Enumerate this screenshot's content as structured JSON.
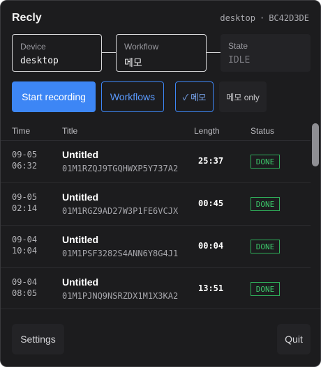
{
  "app": {
    "title": "Recly",
    "device": "desktop",
    "separator": "·",
    "device_id": "BC42D3DE"
  },
  "status_boxes": {
    "device": {
      "label": "Device",
      "value": "desktop"
    },
    "workflow": {
      "label": "Workflow",
      "value": "메모"
    },
    "state": {
      "label": "State",
      "value": "IDLE"
    }
  },
  "toolbar": {
    "start_label": "Start recording",
    "workflows_label": "Workflows",
    "memo_filter_label": "✓ 메모",
    "memo_only_label": "메모 only"
  },
  "table": {
    "columns": {
      "time": "Time",
      "title": "Title",
      "length": "Length",
      "status": "Status"
    },
    "rows": [
      {
        "date": "09-05",
        "time": "06:32",
        "title": "Untitled",
        "id": "01M1RZQJ9TGQHWXP5Y737A2",
        "length": "25:37",
        "status": "DONE"
      },
      {
        "date": "09-05",
        "time": "02:14",
        "title": "Untitled",
        "id": "01M1RGZ9AD27W3P1FE6VCJX",
        "length": "00:45",
        "status": "DONE"
      },
      {
        "date": "09-04",
        "time": "10:04",
        "title": "Untitled",
        "id": "01M1PSF3282S4ANN6Y8G4J1",
        "length": "00:04",
        "status": "DONE"
      },
      {
        "date": "09-04",
        "time": "08:05",
        "title": "Untitled",
        "id": "01M1PJNQ9NSRZDX1M1X3KA2",
        "length": "13:51",
        "status": "DONE"
      }
    ]
  },
  "footer": {
    "settings_label": "Settings",
    "quit_label": "Quit"
  },
  "colors": {
    "accent": "#3d86f5",
    "done": "#3cc76a",
    "background": "#1c1c1e"
  }
}
